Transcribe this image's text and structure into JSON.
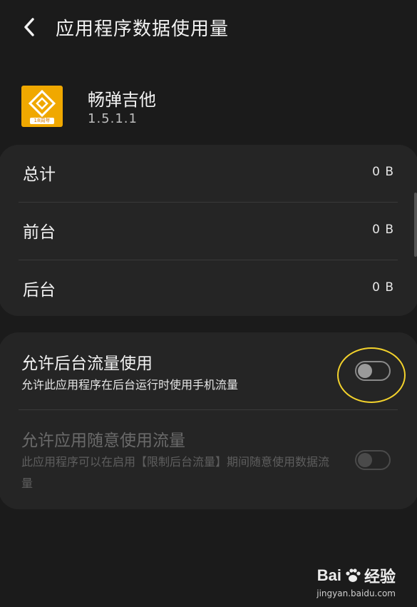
{
  "header": {
    "title": "应用程序数据使用量"
  },
  "app": {
    "name": "畅弹吉他",
    "version": "1.5.1.1",
    "badge": "18周年"
  },
  "usage": {
    "rows": [
      {
        "label": "总计",
        "value": "0 B"
      },
      {
        "label": "前台",
        "value": "0 B"
      },
      {
        "label": "后台",
        "value": "0 B"
      }
    ]
  },
  "settings": {
    "background_data": {
      "title": "允许后台流量使用",
      "description": "允许此应用程序在后台运行时使用手机流量",
      "enabled": false
    },
    "unrestricted_data": {
      "title": "允许应用随意使用流量",
      "description": "此应用程序可以在启用【限制后台流量】期间随意使用数据流量",
      "enabled": false,
      "available": false
    }
  },
  "watermark": {
    "brand_a": "Bai",
    "brand_b": "经验",
    "url": "jingyan.baidu.com"
  },
  "colors": {
    "background": "#1b1b1b",
    "card": "#252525",
    "highlight": "#f3d22c",
    "app_icon": "#f0a800"
  }
}
